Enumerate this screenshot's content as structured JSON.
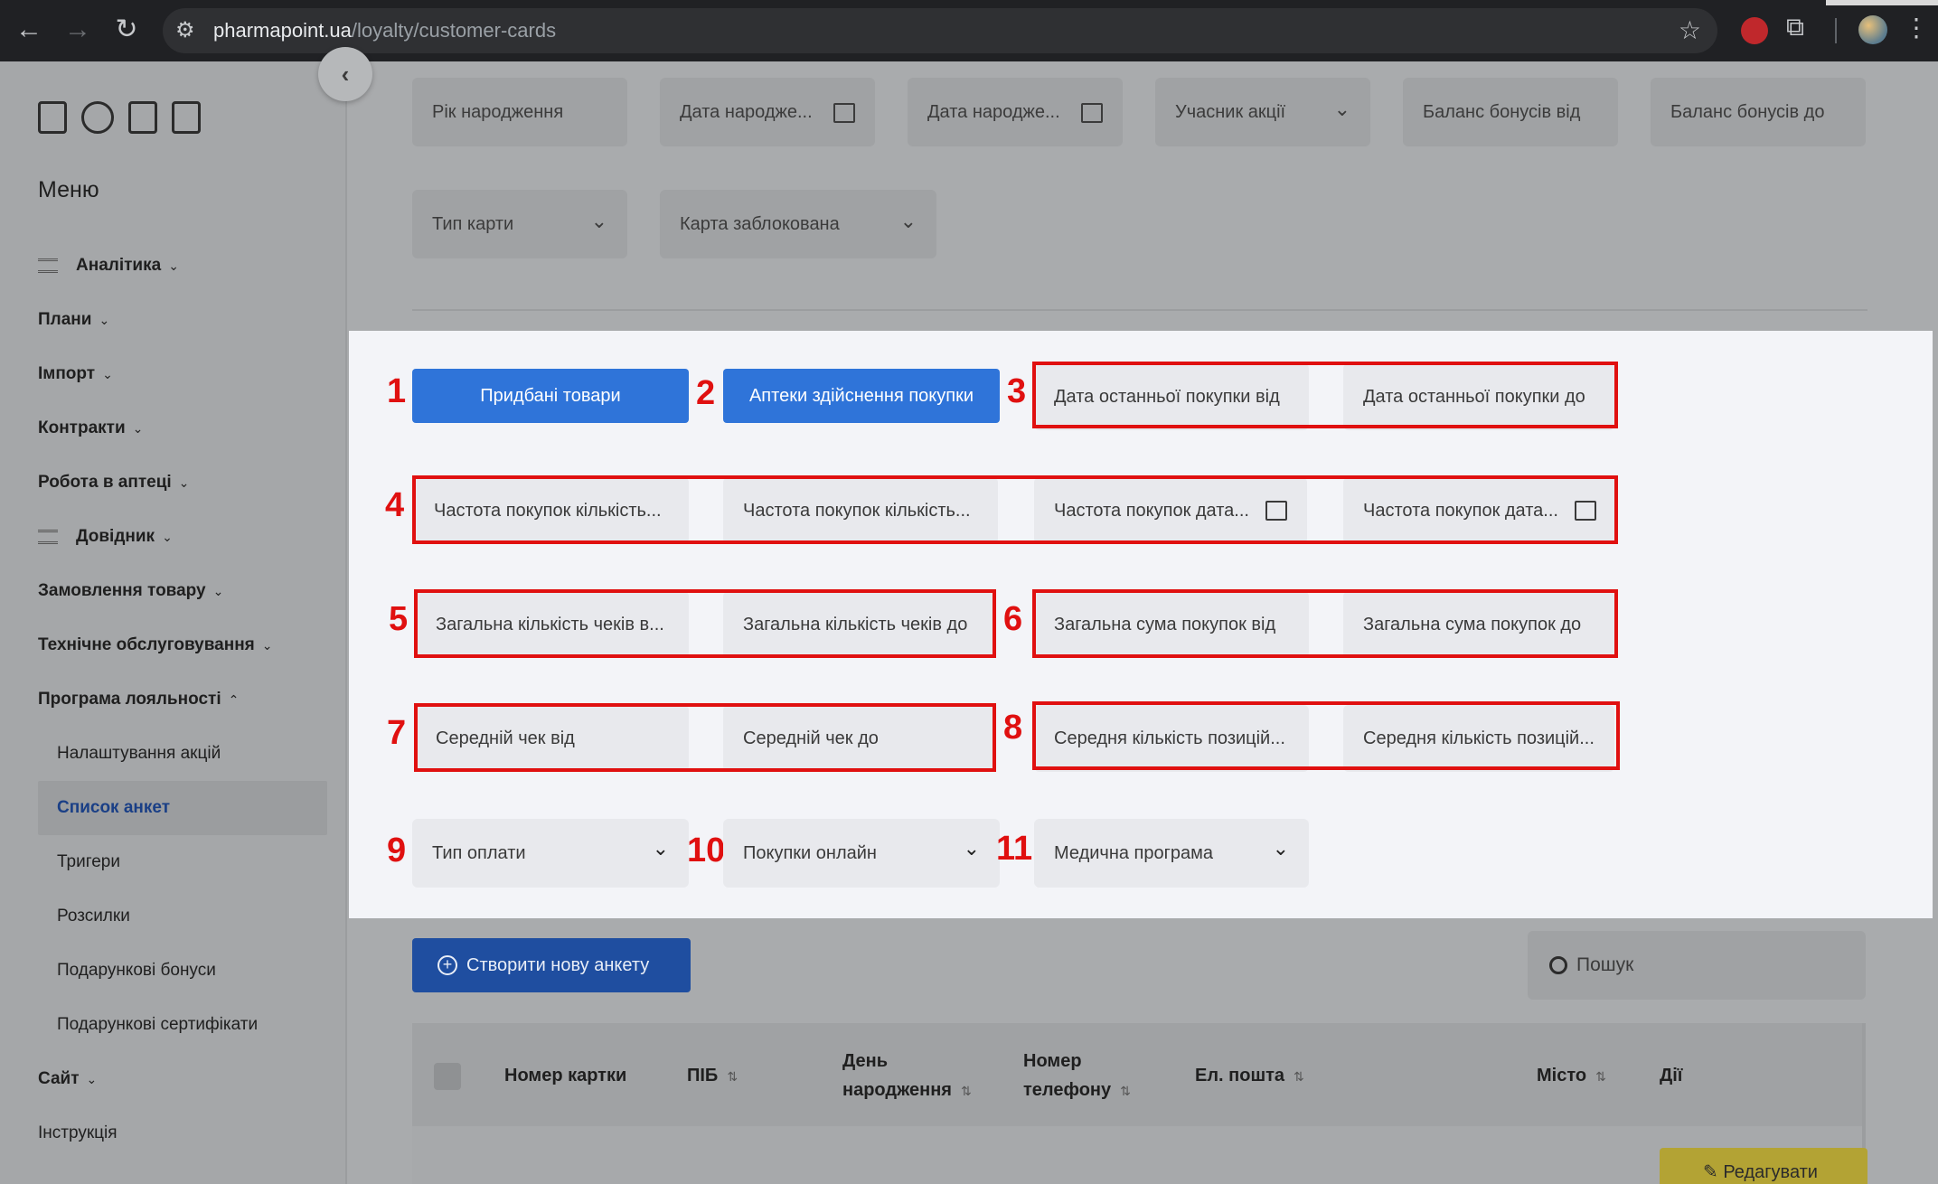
{
  "browser": {
    "url_host": "pharmapoint.ua",
    "url_path": "/loyalty/customer-cards"
  },
  "sidebar": {
    "menu_title": "Меню",
    "items": [
      {
        "label": "Аналітика",
        "chev": "⌄"
      },
      {
        "label": "Плани",
        "chev": "⌄"
      },
      {
        "label": "Імпорт",
        "chev": "⌄"
      },
      {
        "label": "Контракти",
        "chev": "⌄"
      },
      {
        "label": "Робота в аптеці",
        "chev": "⌄"
      },
      {
        "label": "Довідник",
        "chev": "⌄"
      },
      {
        "label": "Замовлення товару",
        "chev": "⌄"
      },
      {
        "label": "Технічне обслуговування",
        "chev": "⌄"
      },
      {
        "label": "Програма лояльності",
        "chev": "⌃"
      },
      {
        "label": "Налаштування акцій"
      },
      {
        "label": "Список анкет"
      },
      {
        "label": "Тригери"
      },
      {
        "label": "Розсилки"
      },
      {
        "label": "Подарункові бонуси"
      },
      {
        "label": "Подарункові сертифікати"
      },
      {
        "label": "Сайт",
        "chev": "⌄"
      },
      {
        "label": "Інструкція"
      }
    ]
  },
  "filters_top": {
    "row1": [
      "Рік народження",
      "Дата народже...",
      "Дата народже...",
      "Учасник акції",
      "Баланс бонусів від",
      "Баланс бонусів до"
    ],
    "row2": [
      "Тип карти",
      "Карта заблокована"
    ]
  },
  "panel": {
    "numbers": [
      "1",
      "2",
      "3",
      "4",
      "5",
      "6",
      "7",
      "8",
      "9",
      "10",
      "11"
    ],
    "btn_purchased": "Придбані товари",
    "btn_pharmacies": "Аптеки здійснення покупки",
    "last_purchase_from": "Дата останньої покупки від",
    "last_purchase_to": "Дата останньої покупки до",
    "freq_count_from": "Частота покупок кількість...",
    "freq_count_to": "Частота покупок кількість...",
    "freq_date_from": "Частота покупок дата...",
    "freq_date_to": "Частота покупок дата...",
    "checks_from": "Загальна кількість чеків в...",
    "checks_to": "Загальна кількість чеків до",
    "sum_from": "Загальна сума покупок від",
    "sum_to": "Загальна сума покупок до",
    "avg_check_from": "Середній чек від",
    "avg_check_to": "Середній чек до",
    "avg_items_from": "Середня кількість позицій...",
    "avg_items_to": "Середня кількість позицій...",
    "payment_type": "Тип оплати",
    "online": "Покупки онлайн",
    "medical": "Медична програма"
  },
  "actions": {
    "create": "Створити нову анкету",
    "search_placeholder": "Пошук",
    "edit": "Редагувати"
  },
  "table": {
    "headers": {
      "card": "Номер картки",
      "name": "ПІБ",
      "birthday_1": "День",
      "birthday_2": "народження",
      "phone_1": "Номер",
      "phone_2": "телефону",
      "email": "Ел. пошта",
      "city": "Місто",
      "actions": "Дії"
    }
  },
  "colors": {
    "accent_blue": "#2f74d9",
    "annotation_red": "#e01010",
    "create_button": "#1f4ea0"
  }
}
